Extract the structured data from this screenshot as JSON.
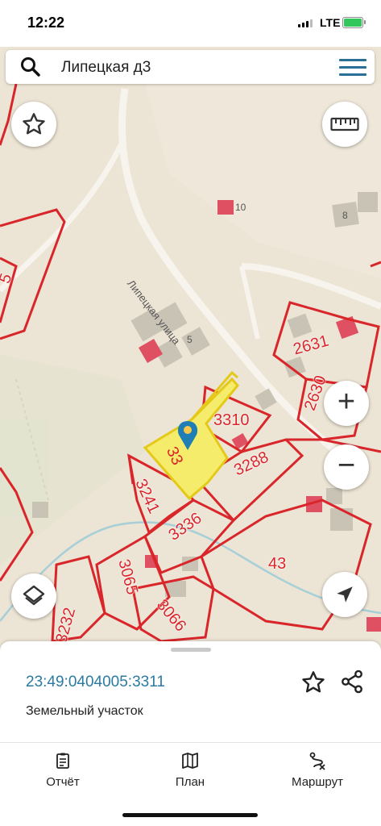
{
  "status_bar": {
    "time": "12:22",
    "network": "LTE"
  },
  "search": {
    "query": "Липецкая д3"
  },
  "map": {
    "street_name": "Липецкая улица",
    "house_numbers": [
      "10",
      "8",
      "5"
    ],
    "selected_parcel_label": "33",
    "parcel_labels": [
      "2631",
      "2630",
      "3310",
      "3288",
      "3241",
      "3336",
      "43",
      "3065",
      "3232",
      "3066",
      "5"
    ],
    "selected_parcel_color": "#f6ec6c",
    "boundary_color": "#d9262b"
  },
  "controls": {
    "favorite": "star-icon",
    "ruler": "ruler-icon",
    "zoom_in": "+",
    "zoom_out": "−",
    "layers": "layers-icon",
    "locate": "location-arrow-icon"
  },
  "sheet": {
    "cadastral_number": "23:49:0404005:3311",
    "object_type": "Земельный участок"
  },
  "tabs": [
    {
      "label": "Отчёт",
      "icon": "report-icon"
    },
    {
      "label": "План",
      "icon": "map-plan-icon"
    },
    {
      "label": "Маршрут",
      "icon": "route-icon"
    }
  ]
}
